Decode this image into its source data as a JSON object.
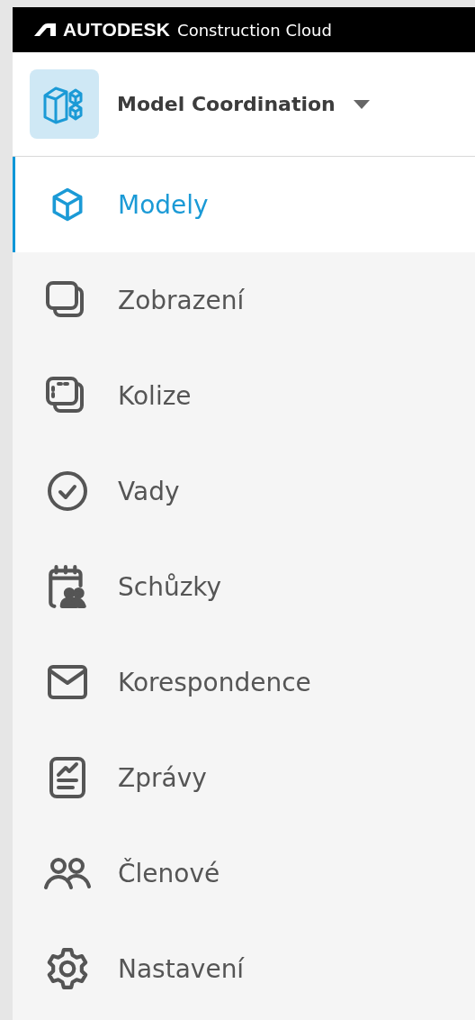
{
  "header": {
    "brand": "AUTODESK",
    "product": "Construction Cloud"
  },
  "module": {
    "title": "Model Coordination"
  },
  "nav": [
    {
      "label": "Modely",
      "selected": true
    },
    {
      "label": "Zobrazení",
      "selected": false
    },
    {
      "label": "Kolize",
      "selected": false
    },
    {
      "label": "Vady",
      "selected": false
    },
    {
      "label": "Schůzky",
      "selected": false
    },
    {
      "label": "Korespondence",
      "selected": false
    },
    {
      "label": "Zprávy",
      "selected": false
    },
    {
      "label": "Členové",
      "selected": false
    },
    {
      "label": "Nastavení",
      "selected": false
    }
  ]
}
